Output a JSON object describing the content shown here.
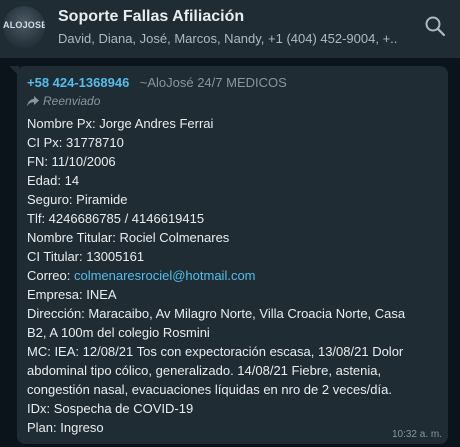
{
  "header": {
    "avatar_text": "ALOJOSÉ",
    "title": "Soporte Fallas Afiliación",
    "participants": "David, Diana, José, Marcos, Nandy, +1 (404) 452-9004, +...",
    "search_icon": "search-icon"
  },
  "message": {
    "sender_phone": "+58 424-1368946",
    "sender_name": "~AloJosé 24/7 MEDICOS",
    "forwarded_label": "Reenviado",
    "forwarded_icon": "forward-arrow-icon",
    "lines": [
      "Nombre Px: Jorge Andres Ferrai",
      "CI Px: 31778710",
      "FN: 11/10/2006",
      "Edad: 14",
      "Seguro: Piramide",
      "Tlf: 4246686785 / 4146619415",
      "Nombre Titular: Rociel Colmenares",
      "CI Titular: 13005161"
    ],
    "correo_label": "Correo: ",
    "correo_email": "colmenaresrociel@hotmail.com",
    "lines2": [
      "Empresa: INEA",
      "Dirección: Maracaibo, Av Milagro Norte, Villa Croacia Norte, Casa",
      "B2, A 100m del colegio Rosmini",
      "MC: IEA: 12/08/21 Tos con expectoración escasa, 13/08/21 Dolor",
      "abdominal tipo cólico, generalizado. 14/08/21 Fiebre, astenia,",
      "congestión nasal, evacuaciones líquidas en nro de 2 veces/día.",
      "IDx: Sospecha de COVID-19",
      "Plan: Ingreso"
    ],
    "timestamp": "10:32 a. m."
  },
  "colors": {
    "background": "#0b141a",
    "header_bg": "#202c33",
    "bubble_bg": "#202c33",
    "link": "#53bdeb",
    "secondary_text": "#8696a0"
  }
}
